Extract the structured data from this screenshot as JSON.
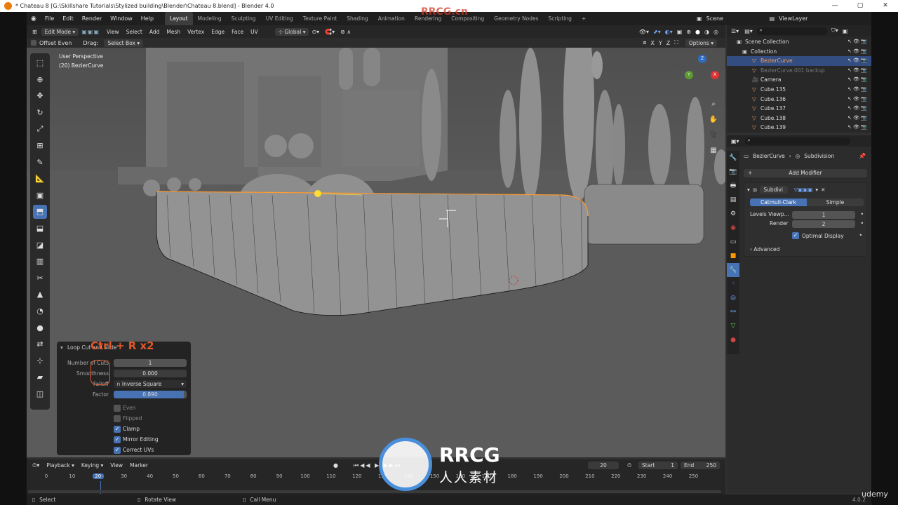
{
  "window": {
    "title": "* Chateau 8 [G:\\Skillshare Tutorials\\Stylized building\\Blender\\Chateau 8.blend] - Blender 4.0",
    "controls": [
      "—",
      "▢",
      "✕"
    ]
  },
  "menu": {
    "items": [
      "File",
      "Edit",
      "Render",
      "Window",
      "Help"
    ],
    "workspaces": [
      "Layout",
      "Modeling",
      "Sculpting",
      "UV Editing",
      "Texture Paint",
      "Shading",
      "Animation",
      "Rendering",
      "Compositing",
      "Geometry Nodes",
      "Scripting"
    ],
    "active_workspace": "Layout",
    "plus": "+",
    "scene_label": "Scene",
    "viewlayer_label": "ViewLayer"
  },
  "viewport_header": {
    "mode": "Edit Mode",
    "menus": [
      "View",
      "Select",
      "Add",
      "Mesh",
      "Vertex",
      "Edge",
      "Face",
      "UV"
    ],
    "orientation": "Global",
    "options": "Options",
    "axes": [
      "X",
      "Y",
      "Z"
    ]
  },
  "tool_header": {
    "offset_even": "Offset Even",
    "drag_label": "Drag:",
    "drag_value": "Select Box"
  },
  "viewport": {
    "perspective": "User Perspective",
    "object_info": "(20) BezierCurve",
    "gizmo": {
      "x": "X",
      "y": "Y",
      "z": "Z"
    }
  },
  "tools": [
    "select-box",
    "cursor",
    "move",
    "rotate",
    "scale",
    "transform",
    "annotate",
    "measure",
    "add-cube",
    "extrude",
    "inset",
    "bevel",
    "loop-cut",
    "knife",
    "poly-build",
    "spin",
    "smooth",
    "edge-slide",
    "shrink",
    "shear",
    "rip"
  ],
  "active_tool_index": 9,
  "operator_panel": {
    "title": "Loop Cut and Slide",
    "overlay_text": "Ctrl + R x2",
    "number_of_cuts_label": "Number of Cuts",
    "number_of_cuts": "1",
    "smoothness_label": "Smoothness",
    "smoothness": "0.000",
    "falloff_label": "Falloff",
    "falloff": "Inverse Square",
    "factor_label": "Factor",
    "factor": "0.890",
    "checkboxes": [
      {
        "label": "Even",
        "checked": false
      },
      {
        "label": "Flipped",
        "checked": false
      },
      {
        "label": "Clamp",
        "checked": true
      },
      {
        "label": "Mirror Editing",
        "checked": true
      },
      {
        "label": "Correct UVs",
        "checked": true
      }
    ]
  },
  "timeline": {
    "menus": [
      "Playback",
      "Keying",
      "View",
      "Marker"
    ],
    "current_frame": "20",
    "start_label": "Start",
    "start": "1",
    "end_label": "End",
    "end": "250",
    "ticks": [
      "0",
      "10",
      "20",
      "30",
      "40",
      "50",
      "60",
      "70",
      "80",
      "90",
      "100",
      "110",
      "120",
      "130",
      "140",
      "150",
      "160",
      "170",
      "180",
      "190",
      "200",
      "210",
      "220",
      "230",
      "240",
      "250"
    ]
  },
  "statusbar": {
    "select": "Select",
    "rotate": "Rotate View",
    "menu": "Call Menu",
    "version": "4.0.2"
  },
  "outliner": {
    "scene_collection": "Scene Collection",
    "collection": "Collection",
    "items": [
      "BezierCurve",
      "BezierCurve.001 backup",
      "Camera",
      "Cube.135",
      "Cube.136",
      "Cube.137",
      "Cube.138",
      "Cube.139"
    ],
    "selected_index": 0
  },
  "properties": {
    "breadcrumb_object": "BezierCurve",
    "breadcrumb_modifier": "Subdivision",
    "add_modifier": "Add Modifier",
    "modifier_name": "Subdivi",
    "catmull": "Catmull-Clark",
    "simple": "Simple",
    "levels_label": "Levels Viewp...",
    "levels": "1",
    "render_label": "Render",
    "render": "2",
    "optimal_display": "Optimal Display",
    "advanced": "Advanced"
  },
  "watermark": {
    "brand": "RRCG",
    "cn": "人人素材",
    "udemy": "udemy",
    "top": "RRCG.cn"
  },
  "colors": {
    "accent": "#4772b3",
    "active_object": "#f0a060",
    "selection": "#ff9c30",
    "overlay_text": "#e0582a"
  }
}
